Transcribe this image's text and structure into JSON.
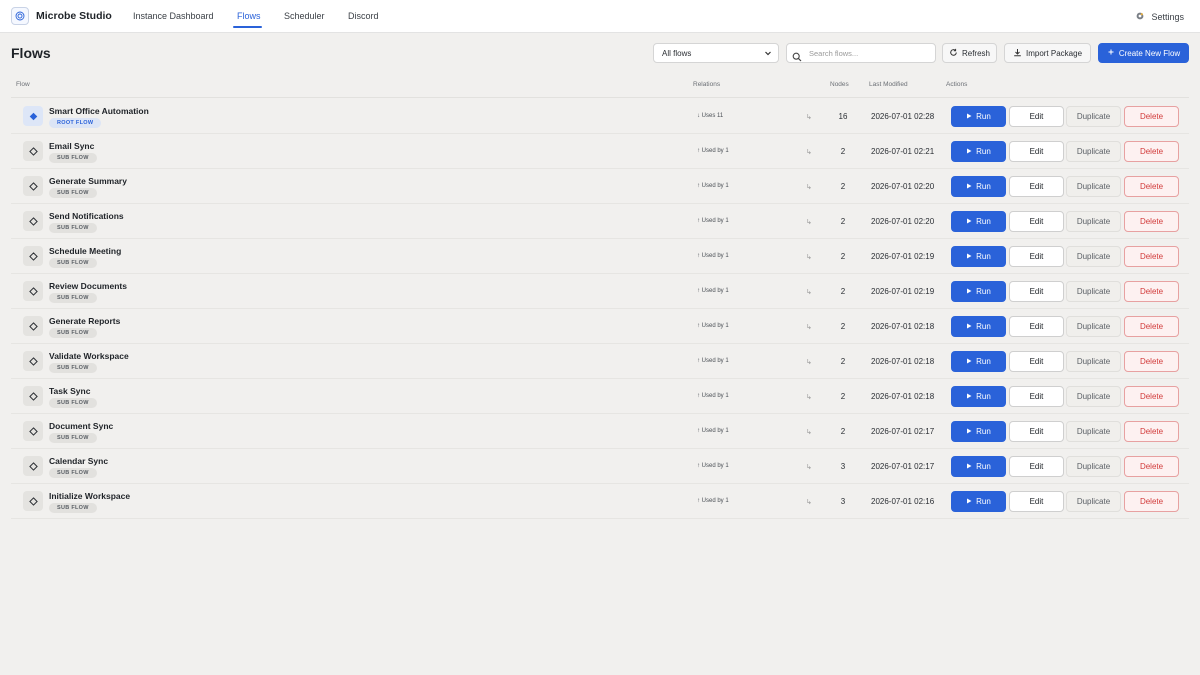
{
  "app": {
    "brand": "Microbe Studio",
    "accent_color": "#2a62d9",
    "danger_color": "#d23b3b"
  },
  "nav": {
    "items": [
      {
        "label": "Instance Dashboard",
        "active": false
      },
      {
        "label": "Flows",
        "active": true
      },
      {
        "label": "Scheduler",
        "active": false
      },
      {
        "label": "Discord",
        "active": false
      }
    ],
    "settings_label": "Settings",
    "settings_icon": "gear-icon"
  },
  "page": {
    "title": "Flows"
  },
  "toolbar": {
    "filter_value": "All flows",
    "search_placeholder": "Search flows...",
    "refresh_label": "Refresh",
    "import_label": "Import Package",
    "create_label": "Create New Flow"
  },
  "table": {
    "headers": {
      "flow": "Flow",
      "relations": "Relations",
      "nodes": "Nodes",
      "modified": "Last Modified",
      "actions": "Actions"
    },
    "action_labels": {
      "run": "Run",
      "edit": "Edit",
      "duplicate": "Duplicate",
      "delete": "Delete"
    },
    "rows": [
      {
        "name": "Smart Office Automation",
        "badge": "ROOT FLOW",
        "root": true,
        "relation": "↓ Uses 11",
        "arrow": "↳",
        "nodes": "16",
        "modified": "2026-07-01 02:28"
      },
      {
        "name": "Email Sync",
        "badge": "SUB FLOW",
        "root": false,
        "relation": "↑ Used by 1",
        "arrow": "↳",
        "nodes": "2",
        "modified": "2026-07-01 02:21"
      },
      {
        "name": "Generate Summary",
        "badge": "SUB FLOW",
        "root": false,
        "relation": "↑ Used by 1",
        "arrow": "↳",
        "nodes": "2",
        "modified": "2026-07-01 02:20"
      },
      {
        "name": "Send Notifications",
        "badge": "SUB FLOW",
        "root": false,
        "relation": "↑ Used by 1",
        "arrow": "↳",
        "nodes": "2",
        "modified": "2026-07-01 02:20"
      },
      {
        "name": "Schedule Meeting",
        "badge": "SUB FLOW",
        "root": false,
        "relation": "↑ Used by 1",
        "arrow": "↳",
        "nodes": "2",
        "modified": "2026-07-01 02:19"
      },
      {
        "name": "Review Documents",
        "badge": "SUB FLOW",
        "root": false,
        "relation": "↑ Used by 1",
        "arrow": "↳",
        "nodes": "2",
        "modified": "2026-07-01 02:19"
      },
      {
        "name": "Generate Reports",
        "badge": "SUB FLOW",
        "root": false,
        "relation": "↑ Used by 1",
        "arrow": "↳",
        "nodes": "2",
        "modified": "2026-07-01 02:18"
      },
      {
        "name": "Validate Workspace",
        "badge": "SUB FLOW",
        "root": false,
        "relation": "↑ Used by 1",
        "arrow": "↳",
        "nodes": "2",
        "modified": "2026-07-01 02:18"
      },
      {
        "name": "Task Sync",
        "badge": "SUB FLOW",
        "root": false,
        "relation": "↑ Used by 1",
        "arrow": "↳",
        "nodes": "2",
        "modified": "2026-07-01 02:18"
      },
      {
        "name": "Document Sync",
        "badge": "SUB FLOW",
        "root": false,
        "relation": "↑ Used by 1",
        "arrow": "↳",
        "nodes": "2",
        "modified": "2026-07-01 02:17"
      },
      {
        "name": "Calendar Sync",
        "badge": "SUB FLOW",
        "root": false,
        "relation": "↑ Used by 1",
        "arrow": "↳",
        "nodes": "3",
        "modified": "2026-07-01 02:17"
      },
      {
        "name": "Initialize Workspace",
        "badge": "SUB FLOW",
        "root": false,
        "relation": "↑ Used by 1",
        "arrow": "↳",
        "nodes": "3",
        "modified": "2026-07-01 02:16"
      }
    ]
  }
}
